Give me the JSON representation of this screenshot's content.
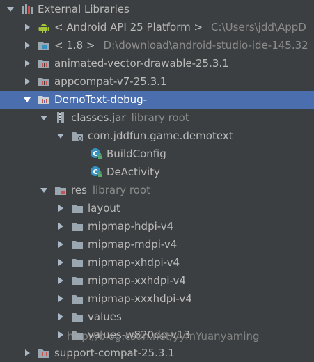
{
  "tree": {
    "root_label": "External Libraries",
    "android_api": {
      "label": "< Android API 25 Platform >",
      "path": "C:\\Users\\jdd\\AppD"
    },
    "jdk": {
      "label": "< 1.8 >",
      "path": "D:\\download\\android-studio-ide-145.32"
    },
    "animated_vector": "animated-vector-drawable-25.3.1",
    "appcompat": "appcompat-v7-25.3.1",
    "demotext": "DemoText-debug-",
    "classes_jar": {
      "label": "classes.jar",
      "hint": "library root"
    },
    "package": "com.jddfun.game.demotext",
    "build_config": "BuildConfig",
    "de_activity": "DeActivity",
    "res": {
      "label": "res",
      "hint": "library root"
    },
    "res_folders": [
      "layout",
      "mipmap-hdpi-v4",
      "mipmap-mdpi-v4",
      "mipmap-xhdpi-v4",
      "mipmap-xxhdpi-v4",
      "mipmap-xxxhdpi-v4",
      "values",
      "values-w820dp-v13"
    ],
    "last_partial": "support-compat-25.3.1"
  },
  "watermark": "http://blog.csdn.net/yymYuanyaming",
  "colors": {
    "background": "#3c3f41",
    "selection": "#4b6eaf",
    "folder": "#9aa7b0",
    "android": "#a4c639",
    "class_circle": "#3592c4",
    "lock": "#59a869"
  }
}
